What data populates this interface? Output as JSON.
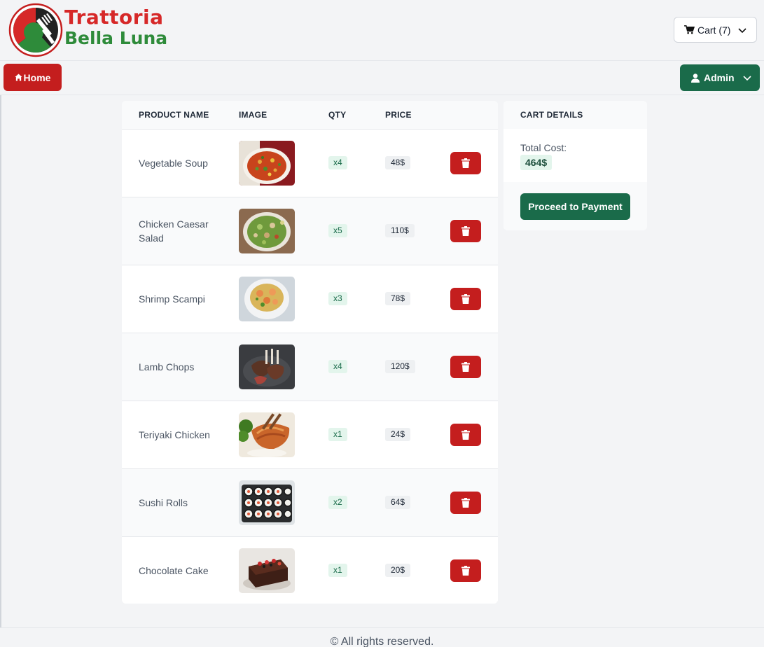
{
  "brand": {
    "line1": "Trattoria",
    "line2": "Bella Luna",
    "colors": {
      "red": "#d62828",
      "green": "#2e8b3a"
    }
  },
  "header": {
    "cart_label": "Cart (7)"
  },
  "nav": {
    "home_label": "Home",
    "admin_label": "Admin"
  },
  "table": {
    "headers": {
      "name": "PRODUCT NAME",
      "image": "IMAGE",
      "qty": "QTY",
      "price": "PRICE"
    },
    "rows": [
      {
        "name": "Vegetable Soup",
        "qty": "x4",
        "price": "48$",
        "image": "vegetable-soup-photo"
      },
      {
        "name": "Chicken Caesar Salad",
        "qty": "x5",
        "price": "110$",
        "image": "caesar-salad-photo"
      },
      {
        "name": "Shrimp Scampi",
        "qty": "x3",
        "price": "78$",
        "image": "shrimp-scampi-photo"
      },
      {
        "name": "Lamb Chops",
        "qty": "x4",
        "price": "120$",
        "image": "lamb-chops-photo"
      },
      {
        "name": "Teriyaki Chicken",
        "qty": "x1",
        "price": "24$",
        "image": "teriyaki-chicken-photo"
      },
      {
        "name": "Sushi Rolls",
        "qty": "x2",
        "price": "64$",
        "image": "sushi-rolls-photo"
      },
      {
        "name": "Chocolate Cake",
        "qty": "x1",
        "price": "20$",
        "image": "chocolate-cake-photo"
      }
    ]
  },
  "details": {
    "title": "CART DETAILS",
    "total_label": "Total Cost:",
    "total_value": "464$",
    "pay_label": "Proceed to Payment"
  },
  "footer": {
    "text": "© All rights reserved."
  },
  "colors": {
    "danger": "#c41e1e",
    "primary": "#1a6b4a",
    "qty_badge_bg": "#e3f5ec",
    "price_badge_bg": "#eef0f2"
  }
}
